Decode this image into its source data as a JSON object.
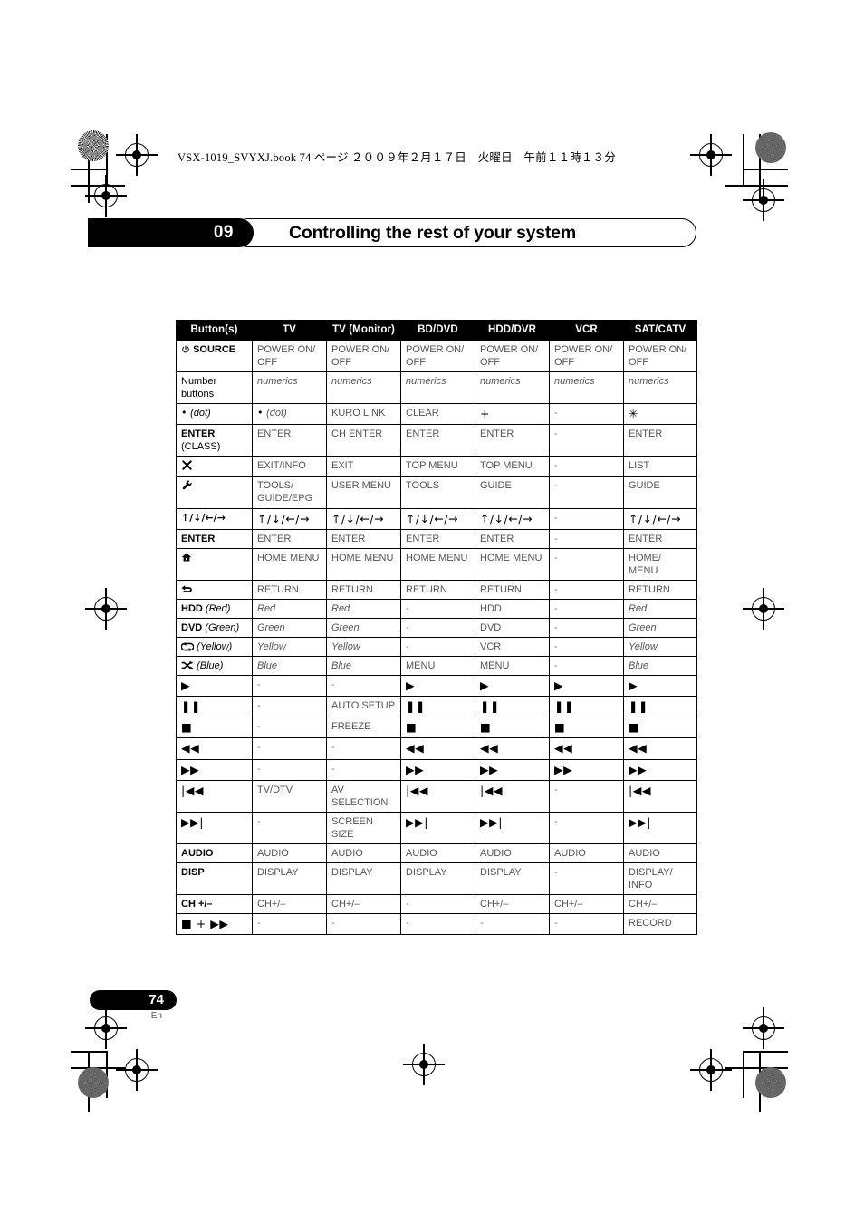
{
  "header": {
    "book_line": "VSX-1019_SVYXJ.book   74 ページ   ２００９年２月１７日　火曜日　午前１１時１３分"
  },
  "chapter": {
    "number": "09",
    "title": "Controlling the rest of your system"
  },
  "table": {
    "columns": [
      "Button(s)",
      "TV",
      "TV (Monitor)",
      "BD/DVD",
      "HDD/DVR",
      "VCR",
      "SAT/CATV"
    ],
    "rows": [
      {
        "button_icon": "power-icon",
        "button_label": "SOURCE",
        "cells": [
          "POWER ON/ OFF",
          "POWER ON/ OFF",
          "POWER ON/ OFF",
          "POWER ON/ OFF",
          "POWER ON/ OFF",
          "POWER ON/ OFF"
        ]
      },
      {
        "button_label": "Number buttons",
        "cells": [
          "numerics",
          "numerics",
          "numerics",
          "numerics",
          "numerics",
          "numerics"
        ]
      },
      {
        "button_label": "• (dot)",
        "cells": [
          "• (dot)",
          "KURO LINK",
          "CLEAR",
          "+",
          "-",
          "✳"
        ]
      },
      {
        "button_label": "ENTER (CLASS)",
        "cells": [
          "ENTER",
          "CH ENTER",
          "ENTER",
          "ENTER",
          "-",
          "ENTER"
        ]
      },
      {
        "button_icon": "close-x-icon",
        "button_label": "",
        "cells": [
          "EXIT/INFO",
          "EXIT",
          "TOP MENU",
          "TOP MENU",
          "-",
          "LIST"
        ]
      },
      {
        "button_icon": "wrench-icon",
        "button_label": "",
        "cells": [
          "TOOLS/ GUIDE/EPG",
          "USER MENU",
          "TOOLS",
          "GUIDE",
          "-",
          "GUIDE"
        ]
      },
      {
        "button_label": "↑/↓/←/→",
        "cells": [
          "↑/↓/←/→",
          "↑/↓/←/→",
          "↑/↓/←/→",
          "↑/↓/←/→",
          "-",
          "↑/↓/←/→"
        ]
      },
      {
        "button_label": "ENTER",
        "cells": [
          "ENTER",
          "ENTER",
          "ENTER",
          "ENTER",
          "-",
          "ENTER"
        ]
      },
      {
        "button_icon": "home-icon",
        "button_label": "",
        "cells": [
          "HOME MENU",
          "HOME MENU",
          "HOME MENU",
          "HOME MENU",
          "-",
          "HOME/ MENU"
        ]
      },
      {
        "button_icon": "return-arrow-icon",
        "button_label": "",
        "cells": [
          "RETURN",
          "RETURN",
          "RETURN",
          "RETURN",
          "-",
          "RETURN"
        ]
      },
      {
        "button_label": "HDD (Red)",
        "cells": [
          "Red",
          "Red",
          "-",
          "HDD",
          "-",
          "Red"
        ]
      },
      {
        "button_label": "DVD (Green)",
        "cells": [
          "Green",
          "Green",
          "-",
          "DVD",
          "-",
          "Green"
        ]
      },
      {
        "button_icon": "repeat-icon",
        "button_label": "(Yellow)",
        "cells": [
          "Yellow",
          "Yellow",
          "-",
          "VCR",
          "-",
          "Yellow"
        ]
      },
      {
        "button_icon": "shuffle-icon",
        "button_label": "(Blue)",
        "cells": [
          "Blue",
          "Blue",
          "MENU",
          "MENU",
          "-",
          "Blue"
        ]
      },
      {
        "button_label": "▶",
        "cells": [
          "-",
          "-",
          "▶",
          "▶",
          "▶",
          "▶"
        ]
      },
      {
        "button_label": "❚❚",
        "cells": [
          "-",
          "AUTO SETUP",
          "❚❚",
          "❚❚",
          "❚❚",
          "❚❚"
        ]
      },
      {
        "button_label": "■",
        "cells": [
          "-",
          "FREEZE",
          "■",
          "■",
          "■",
          "■"
        ]
      },
      {
        "button_label": "◀◀",
        "cells": [
          "-",
          "-",
          "◀◀",
          "◀◀",
          "◀◀",
          "◀◀"
        ]
      },
      {
        "button_label": "▶▶",
        "cells": [
          "-",
          "-",
          "▶▶",
          "▶▶",
          "▶▶",
          "▶▶"
        ]
      },
      {
        "button_label": "|◀◀",
        "cells": [
          "TV/DTV",
          "AV SELECTION",
          "|◀◀",
          "|◀◀",
          "-",
          "|◀◀"
        ]
      },
      {
        "button_label": "▶▶|",
        "cells": [
          "-",
          "SCREEN SIZE",
          "▶▶|",
          "▶▶|",
          "-",
          "▶▶|"
        ]
      },
      {
        "button_label": "AUDIO",
        "cells": [
          "AUDIO",
          "AUDIO",
          "AUDIO",
          "AUDIO",
          "AUDIO",
          "AUDIO"
        ]
      },
      {
        "button_label": "DISP",
        "cells": [
          "DISPLAY",
          "DISPLAY",
          "DISPLAY",
          "DISPLAY",
          "-",
          "DISPLAY/ INFO"
        ]
      },
      {
        "button_label": "CH +/–",
        "cells": [
          "CH+/–",
          "CH+/–",
          "-",
          "CH+/–",
          "CH+/–",
          "CH+/–"
        ]
      },
      {
        "button_label": "■ + ▶▶",
        "cells": [
          "-",
          "-",
          "-",
          "-",
          "-",
          "RECORD"
        ]
      }
    ]
  },
  "footer": {
    "page_number": "74",
    "language": "En"
  }
}
